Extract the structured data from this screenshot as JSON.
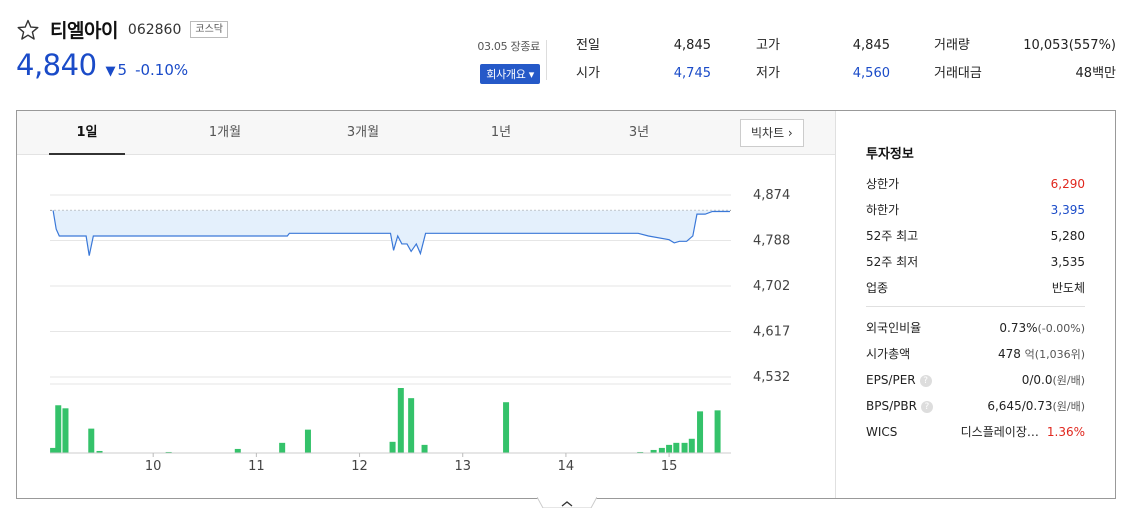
{
  "stock": {
    "name": "티엘아이",
    "code": "062860",
    "market": "코스닥",
    "price": "4,840",
    "change_direction": "▼",
    "change": "5",
    "change_pct": "-0.10%"
  },
  "header": {
    "date_status": "03.05 장종료",
    "company_button": "회사개요 ▾"
  },
  "stats": [
    {
      "label": "전일",
      "value": "4,845",
      "color": "#222222"
    },
    {
      "label": "시가",
      "value": "4,745",
      "color": "#1a4bc8"
    },
    {
      "label": "고가",
      "value": "4,845",
      "color": "#222222"
    },
    {
      "label": "저가",
      "value": "4,560",
      "color": "#1a4bc8"
    },
    {
      "label": "거래량",
      "value": "10,053(557%)",
      "color": "#222222"
    },
    {
      "label": "거래대금",
      "value": "48백만",
      "color": "#222222"
    }
  ],
  "tabs": [
    "1일",
    "1개월",
    "3개월",
    "1년",
    "3년"
  ],
  "active_tab": "1일",
  "big_chart_label": "빅차트 ›",
  "sidebar": {
    "title": "투자정보",
    "upper_limit_label": "상한가",
    "upper_limit": "6,290",
    "lower_limit_label": "하한가",
    "lower_limit": "3,395",
    "high52_label": "52주 최고",
    "high52": "5,280",
    "low52_label": "52주 최저",
    "low52": "3,535",
    "sector_label": "업종",
    "sector": "반도체",
    "foreign_label": "외국인비율",
    "foreign": "0.73%",
    "foreign_change": "(-0.00%)",
    "marketcap_label": "시가총액",
    "marketcap": "478",
    "marketcap_unit": "억(1,036위)",
    "eps_per_label": "EPS/PER",
    "eps_per": "0/0.0",
    "eps_per_unit": "(원/배)",
    "bps_pbr_label": "BPS/PBR",
    "bps_pbr": "6,645/0.73",
    "bps_pbr_unit": "(원/배)",
    "wics_label": "WICS",
    "wics_sector": "디스플레이장…",
    "wics_pct": "1.36%",
    "help_icon": "?"
  },
  "chart_data": {
    "type": "line",
    "y_ticks": [
      "4,874",
      "4,788",
      "4,702",
      "4,617",
      "4,532"
    ],
    "x_ticks": [
      "10",
      "11",
      "12",
      "13",
      "14",
      "15"
    ],
    "ylim": [
      4532,
      4874
    ],
    "reference_price": 4845,
    "x_start": 9.0,
    "x_end": 15.6,
    "price_series": [
      [
        9.03,
        4845
      ],
      [
        9.06,
        4810
      ],
      [
        9.09,
        4797
      ],
      [
        9.35,
        4797
      ],
      [
        9.38,
        4760
      ],
      [
        9.42,
        4797
      ],
      [
        11.3,
        4797
      ],
      [
        11.32,
        4802
      ],
      [
        12.3,
        4802
      ],
      [
        12.33,
        4770
      ],
      [
        12.37,
        4797
      ],
      [
        12.41,
        4782
      ],
      [
        12.46,
        4782
      ],
      [
        12.5,
        4768
      ],
      [
        12.55,
        4782
      ],
      [
        12.59,
        4764
      ],
      [
        12.64,
        4802
      ],
      [
        14.7,
        4802
      ],
      [
        14.8,
        4797
      ],
      [
        15.0,
        4790
      ],
      [
        15.05,
        4784
      ],
      [
        15.1,
        4787
      ],
      [
        15.17,
        4787
      ],
      [
        15.23,
        4797
      ],
      [
        15.27,
        4838
      ],
      [
        15.35,
        4838
      ],
      [
        15.42,
        4843
      ],
      [
        15.59,
        4843
      ]
    ],
    "volume_series": [
      [
        9.03,
        5
      ],
      [
        9.08,
        47
      ],
      [
        9.15,
        44
      ],
      [
        9.4,
        24
      ],
      [
        9.48,
        2
      ],
      [
        10.15,
        1
      ],
      [
        10.82,
        4
      ],
      [
        11.25,
        10
      ],
      [
        11.5,
        23
      ],
      [
        12.32,
        11
      ],
      [
        12.4,
        64
      ],
      [
        12.5,
        54
      ],
      [
        12.63,
        8
      ],
      [
        13.42,
        50
      ],
      [
        14.72,
        1
      ],
      [
        14.85,
        3
      ],
      [
        14.93,
        5
      ],
      [
        15.0,
        8
      ],
      [
        15.07,
        10
      ],
      [
        15.15,
        10
      ],
      [
        15.22,
        14
      ],
      [
        15.3,
        41
      ],
      [
        15.47,
        42
      ]
    ],
    "volume_color": "#34c26a",
    "line_color": "#3a78d8",
    "fill_color": "#e4f0fc"
  }
}
